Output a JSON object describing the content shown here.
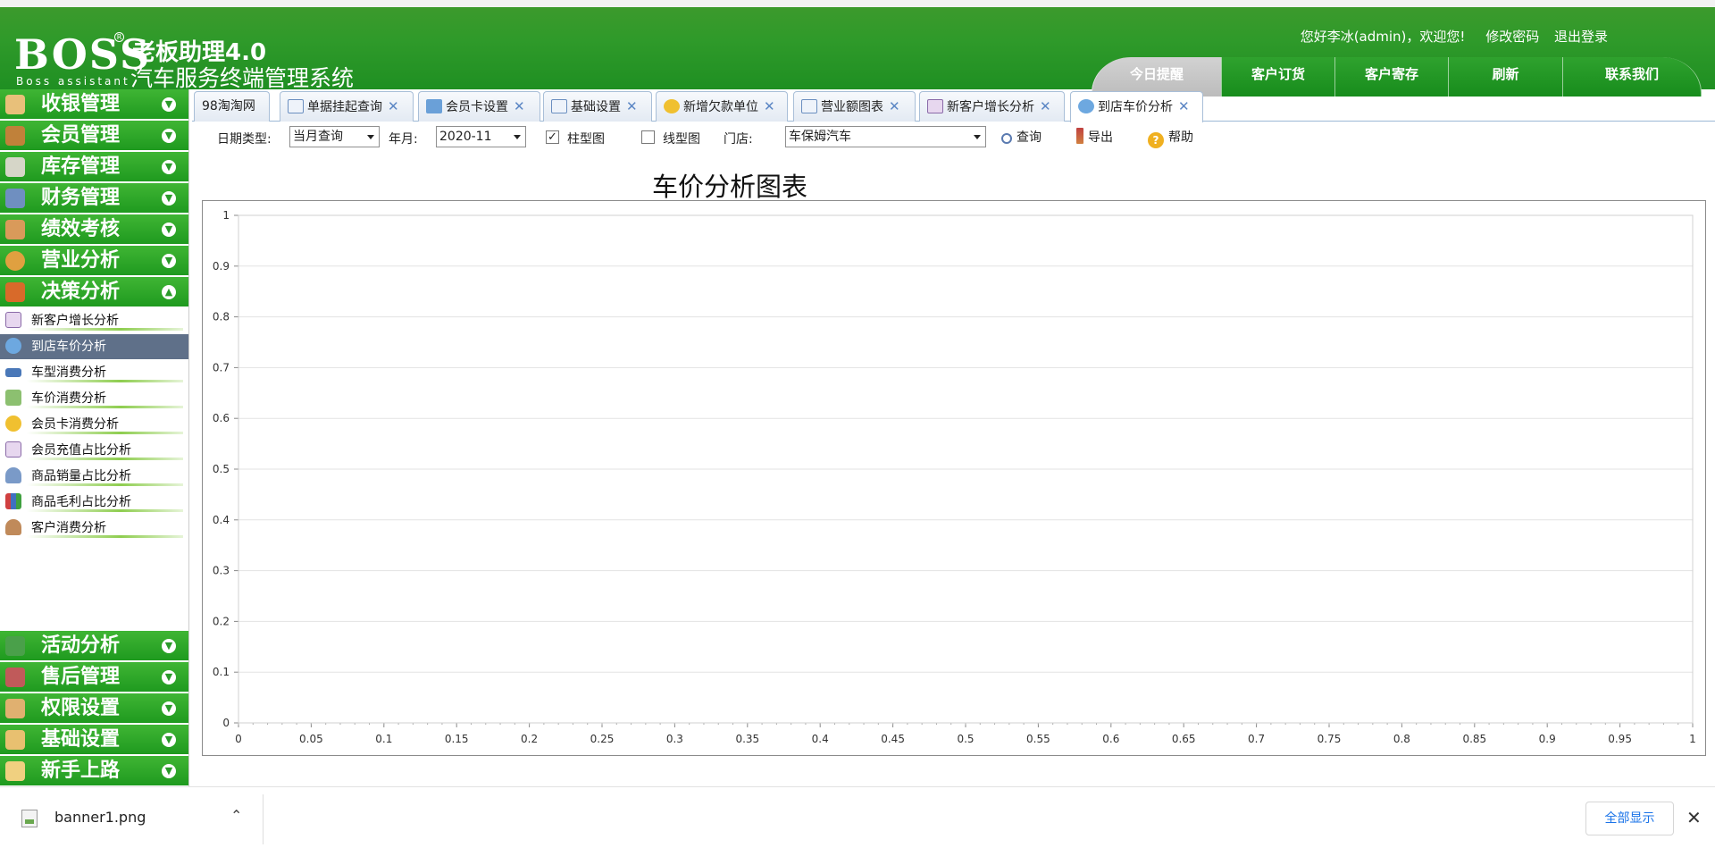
{
  "header": {
    "logo_text": "BOSS",
    "logo_sub": "Boss assistant",
    "title_line1": "老板助理4.0",
    "title_line2": "汽车服务终端管理系统",
    "greeting": "您好李冰(admin)，欢迎您!",
    "change_password": "修改密码",
    "logout": "退出登录",
    "nav": [
      "今日提醒",
      "客户订货",
      "客户寄存",
      "刷新",
      "联系我们"
    ]
  },
  "sidebar": {
    "top_menus": [
      {
        "label": "收银管理",
        "icon": "cashier-icon"
      },
      {
        "label": "会员管理",
        "icon": "member-icon"
      },
      {
        "label": "库存管理",
        "icon": "inventory-icon"
      },
      {
        "label": "财务管理",
        "icon": "finance-icon"
      },
      {
        "label": "绩效考核",
        "icon": "performance-icon"
      },
      {
        "label": "营业分析",
        "icon": "business-analysis-icon"
      },
      {
        "label": "决策分析",
        "icon": "decision-analysis-icon"
      }
    ],
    "sub_items": [
      {
        "label": "新客户增长分析",
        "icon": "chart-line-icon"
      },
      {
        "label": "到店车价分析",
        "icon": "pie-chart-icon"
      },
      {
        "label": "车型消费分析",
        "icon": "car-icon"
      },
      {
        "label": "车价消费分析",
        "icon": "money-icon"
      },
      {
        "label": "会员卡消费分析",
        "icon": "coins-icon"
      },
      {
        "label": "会员充值占比分析",
        "icon": "chart-line-icon"
      },
      {
        "label": "商品销量占比分析",
        "icon": "user-icon"
      },
      {
        "label": "商品毛利占比分析",
        "icon": "bar-chart-icon"
      },
      {
        "label": "客户消费分析",
        "icon": "customer-icon"
      }
    ],
    "active_sub": "到店车价分析",
    "bottom_menus": [
      {
        "label": "活动分析",
        "icon": "activity-icon"
      },
      {
        "label": "售后管理",
        "icon": "after-sales-icon"
      },
      {
        "label": "权限设置",
        "icon": "permission-icon"
      },
      {
        "label": "基础设置",
        "icon": "settings-icon"
      },
      {
        "label": "新手上路",
        "icon": "beginner-icon"
      }
    ]
  },
  "tabs": [
    {
      "label": "98淘淘网",
      "closable": false
    },
    {
      "label": "单据挂起查询",
      "closable": true
    },
    {
      "label": "会员卡设置",
      "closable": true
    },
    {
      "label": "基础设置",
      "closable": true
    },
    {
      "label": "新增欠款单位",
      "closable": true
    },
    {
      "label": "营业额图表",
      "closable": true
    },
    {
      "label": "新客户增长分析",
      "closable": true
    },
    {
      "label": "到店车价分析",
      "closable": true
    }
  ],
  "toolbar": {
    "date_type_label": "日期类型:",
    "date_type_value": "当月查询",
    "month_label": "年月:",
    "month_value": "2020-11",
    "bar_chart_label": "柱型图",
    "bar_chart_checked": true,
    "line_chart_label": "线型图",
    "line_chart_checked": false,
    "store_label": "门店:",
    "store_value": "车保姆汽车",
    "query_label": "查询",
    "export_label": "导出",
    "help_label": "帮助"
  },
  "chart_data": {
    "type": "bar",
    "title": "车价分析图表",
    "series": [],
    "xlim": [
      0,
      1
    ],
    "ylim": [
      0,
      1
    ],
    "x_ticks": [
      "0",
      "0.05",
      "0.1",
      "0.15",
      "0.2",
      "0.25",
      "0.3",
      "0.35",
      "0.4",
      "0.45",
      "0.5",
      "0.55",
      "0.6",
      "0.65",
      "0.7",
      "0.75",
      "0.8",
      "0.85",
      "0.9",
      "0.95",
      "1"
    ],
    "y_ticks": [
      "0",
      "0.1",
      "0.2",
      "0.3",
      "0.4",
      "0.5",
      "0.6",
      "0.7",
      "0.8",
      "0.9",
      "1"
    ],
    "grid": true
  },
  "download_bar": {
    "filename": "banner1.png",
    "show_all": "全部显示",
    "close": "✕"
  },
  "colors": {
    "header_green": "#2f9a2a",
    "menu_green": "#2aa62a",
    "active_item": "#5f7089",
    "tab_border": "#a9bfd8"
  }
}
